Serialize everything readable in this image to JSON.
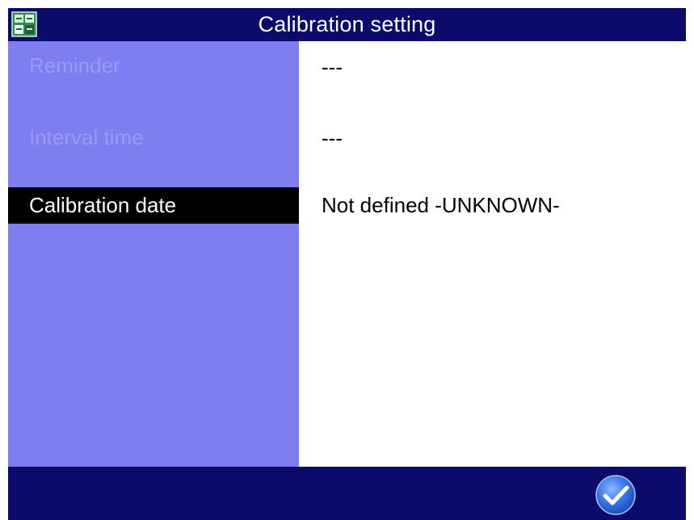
{
  "window": {
    "title": "Calibration setting",
    "app_icon": "device-menu-icon"
  },
  "settings": [
    {
      "label": "Reminder",
      "value": "---",
      "enabled": false,
      "selected": false
    },
    {
      "label": "Interval time",
      "value": "---",
      "enabled": false,
      "selected": false
    },
    {
      "label": "Calibration date",
      "value": "Not defined -UNKNOWN-",
      "enabled": true,
      "selected": true
    }
  ],
  "footer": {
    "confirm_icon": "checkmark-icon"
  },
  "colors": {
    "title_bar": "#0b0b6b",
    "label_column": "#7e7ef1",
    "disabled_text": "#9a9af6",
    "selected_row": "#000000",
    "confirm_button": "#3b78e7"
  }
}
